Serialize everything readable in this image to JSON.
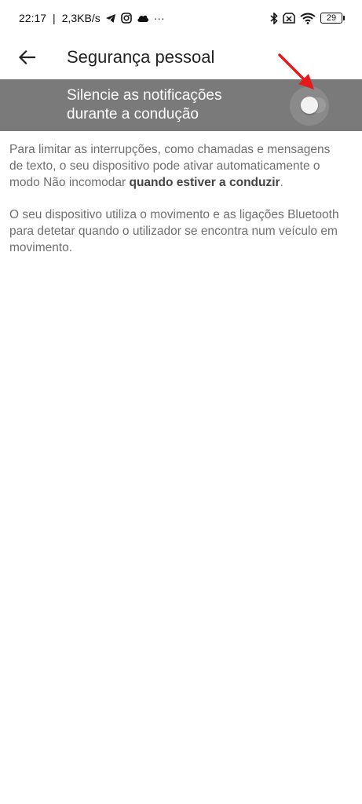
{
  "status_bar": {
    "time": "22:17",
    "separator": "|",
    "net_speed": "2,3KB/s",
    "more": "···",
    "battery": "29",
    "left_icons": [
      "telegram-icon",
      "instagram-icon",
      "cloud-icon"
    ],
    "right_icons": [
      "bluetooth-icon",
      "no-sim-icon",
      "wifi-icon",
      "battery-icon"
    ]
  },
  "app_bar": {
    "title": "Segurança pessoal"
  },
  "toggle": {
    "label": "Silencie as notificações durante a condução",
    "state": "off",
    "row_color": "#7a7a7a"
  },
  "description": {
    "p1_start": "Para limitar as interrupções, como chamadas e mensagens de texto, o seu dispositivo pode ativar automaticamente o modo Não incomodar ",
    "p1_bold": "quando estiver a conduzir",
    "p1_end": ".",
    "p2": "O seu dispositivo utiliza o movimento e as ligações Bluetooth para detetar quando o utilizador se encontra num veículo em movimento."
  },
  "annotation": {
    "arrow_color": "#e8191c"
  }
}
